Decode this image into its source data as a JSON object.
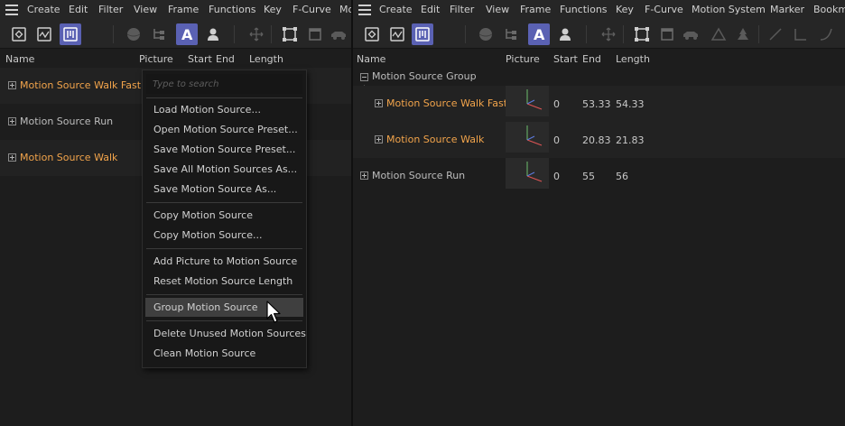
{
  "left": {
    "menu": [
      "Create",
      "Edit",
      "Filter",
      "View",
      "Frame",
      "Functions",
      "Key",
      "F-Curve",
      "Mo"
    ],
    "columns": {
      "name": "Name",
      "picture": "Picture",
      "start": "Start",
      "end": "End",
      "length": "Length"
    },
    "rows": [
      {
        "name": "Motion Source Walk Fast",
        "color": "#f2a44b"
      },
      {
        "name": "Motion Source Run",
        "color": "#bdbdbd"
      },
      {
        "name": "Motion Source Walk",
        "color": "#f2a44b"
      }
    ]
  },
  "context_menu": {
    "search_placeholder": "Type to search",
    "groups": [
      [
        "Load Motion Source...",
        "Open Motion Source Preset...",
        "Save Motion Source Preset...",
        "Save All Motion Sources As...",
        "Save Motion Source As..."
      ],
      [
        "Copy Motion Source",
        "Copy Motion Source..."
      ],
      [
        "Add Picture to Motion Source",
        "Reset Motion Source Length"
      ],
      [
        "Group Motion Source"
      ],
      [
        "Delete Unused Motion Sources",
        "Clean Motion Source"
      ]
    ],
    "hovered_item": "Group Motion Source"
  },
  "right": {
    "menu": [
      "Create",
      "Edit",
      "Filter",
      "View",
      "Frame",
      "Functions",
      "Key",
      "F-Curve",
      "Motion System",
      "Marker",
      "Bookm"
    ],
    "columns": {
      "name": "Name",
      "picture": "Picture",
      "start": "Start",
      "end": "End",
      "length": "Length"
    },
    "group": {
      "name": "Motion Source Group"
    },
    "children": [
      {
        "name": "Motion Source Walk Fast",
        "start": "0",
        "end": "53.33",
        "length": "54.33",
        "color": "#f2a44b"
      },
      {
        "name": "Motion Source Walk",
        "start": "0",
        "end": "20.83",
        "length": "21.83",
        "color": "#f2a44b"
      }
    ],
    "sibling": {
      "name": "Motion Source Run",
      "start": "0",
      "end": "55",
      "length": "56",
      "color": "#bdbdbd"
    }
  },
  "toolbar_icons": {
    "left": [
      "keyframe-mode-icon",
      "fcurve-mode-icon",
      "motion-mode-icon",
      "sphere-icon",
      "hierarchy-icon",
      "text-a-icon",
      "user-icon",
      "move-icon",
      "frame-icon",
      "clapper-icon",
      "car-icon"
    ],
    "right": [
      "keyframe-mode-icon",
      "fcurve-mode-icon",
      "motion-mode-icon",
      "sphere-icon",
      "hierarchy-icon",
      "text-a-icon",
      "user-icon",
      "move-icon",
      "frame-icon",
      "clapper-icon",
      "car-icon",
      "triangle-icon",
      "tree-icon",
      "linear-curve-icon",
      "step-curve-icon",
      "ease-curve-icon"
    ]
  },
  "colors": {
    "accent": "#5a61b3",
    "orange_label": "#f2a44b",
    "background": "#1d1d1d"
  }
}
